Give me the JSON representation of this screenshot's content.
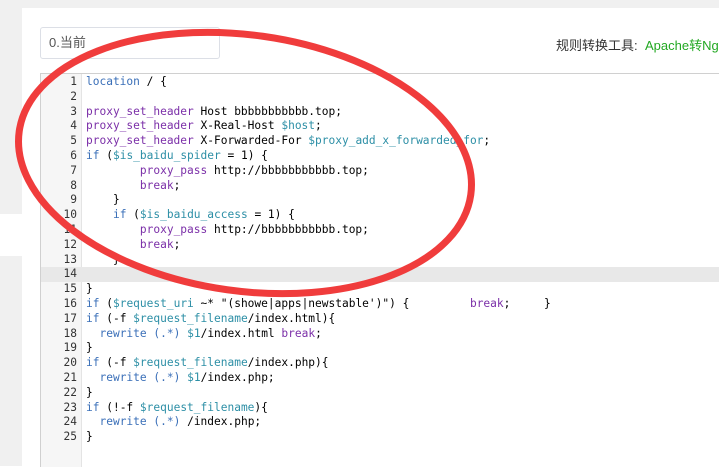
{
  "header": {
    "version_select": "0.当前",
    "tool_label": "规则转换工具:",
    "tool_link": "Apache转Ng"
  },
  "editor": {
    "lines": [
      {
        "n": "1",
        "t": "location / {"
      },
      {
        "n": "2",
        "t": ""
      },
      {
        "n": "3",
        "t": "proxy_set_header Host bbbbbbbbbbb.top;"
      },
      {
        "n": "4",
        "t": "proxy_set_header X-Real-Host $host;"
      },
      {
        "n": "5",
        "t": "proxy_set_header X-Forwarded-For $proxy_add_x_forwarded_for;"
      },
      {
        "n": "6",
        "t": "if ($is_baidu_spider = 1) {"
      },
      {
        "n": "7",
        "t": "        proxy_pass http://bbbbbbbbbbb.top;"
      },
      {
        "n": "8",
        "t": "        break;"
      },
      {
        "n": "9",
        "t": "    }"
      },
      {
        "n": "10",
        "t": "    if ($is_baidu_access = 1) {"
      },
      {
        "n": "11",
        "t": "        proxy_pass http://bbbbbbbbbbb.top;"
      },
      {
        "n": "12",
        "t": "        break;"
      },
      {
        "n": "13",
        "t": "    }"
      },
      {
        "n": "14",
        "t": ""
      },
      {
        "n": "15",
        "t": "}"
      },
      {
        "n": "16",
        "t": "if ($request_uri ~* \"(showe|apps|newstable')\") {         break;     }"
      },
      {
        "n": "17",
        "t": "if (-f $request_filename/index.html){"
      },
      {
        "n": "18",
        "t": "  rewrite (.*) $1/index.html break;"
      },
      {
        "n": "19",
        "t": "}"
      },
      {
        "n": "20",
        "t": "if (-f $request_filename/index.php){"
      },
      {
        "n": "21",
        "t": "  rewrite (.*) $1/index.php;"
      },
      {
        "n": "22",
        "t": "}"
      },
      {
        "n": "23",
        "t": "if (!-f $request_filename){"
      },
      {
        "n": "24",
        "t": "  rewrite (.*) /index.php;"
      },
      {
        "n": "25",
        "t": "}"
      }
    ],
    "active_line": "14"
  },
  "colors": {
    "annotation_red": "#f03c3c",
    "link_green": "#22a822"
  }
}
